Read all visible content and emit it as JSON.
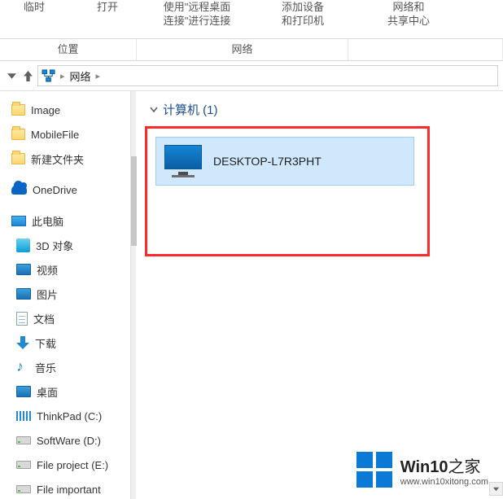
{
  "ribbon": {
    "items": [
      {
        "line1": "临时",
        "line2": ""
      },
      {
        "line1": "打开",
        "line2": ""
      },
      {
        "line1": "使用\"远程桌面",
        "line2": "连接\"进行连接"
      },
      {
        "line1": "添加设备",
        "line2": "和打印机"
      },
      {
        "line1": "网络和",
        "line2": "共享中心"
      }
    ],
    "sections": [
      "位置",
      "网络",
      ""
    ]
  },
  "address": {
    "crumb": "网络"
  },
  "sidebar": {
    "items": [
      {
        "label": "Image",
        "icon": "folder",
        "depth": 0
      },
      {
        "label": "MobileFile",
        "icon": "folder",
        "depth": 0
      },
      {
        "label": "新建文件夹",
        "icon": "folder",
        "depth": 0
      },
      {
        "label": "",
        "icon": "spacer",
        "depth": 0
      },
      {
        "label": "OneDrive",
        "icon": "onedrive",
        "depth": 0
      },
      {
        "label": "",
        "icon": "spacer",
        "depth": 0
      },
      {
        "label": "此电脑",
        "icon": "thispc",
        "depth": 0
      },
      {
        "label": "3D 对象",
        "icon": "obj3d",
        "depth": 1
      },
      {
        "label": "视频",
        "icon": "video",
        "depth": 1
      },
      {
        "label": "图片",
        "icon": "pic",
        "depth": 1
      },
      {
        "label": "文档",
        "icon": "doc",
        "depth": 1
      },
      {
        "label": "下载",
        "icon": "dl",
        "depth": 1
      },
      {
        "label": "音乐",
        "icon": "music",
        "depth": 1
      },
      {
        "label": "桌面",
        "icon": "desk",
        "depth": 1
      },
      {
        "label": "ThinkPad (C:)",
        "icon": "tp",
        "depth": 1
      },
      {
        "label": "SoftWare (D:)",
        "icon": "drive",
        "depth": 1
      },
      {
        "label": "File project (E:)",
        "icon": "drive",
        "depth": 1
      },
      {
        "label": "File important",
        "icon": "drive",
        "depth": 1
      }
    ]
  },
  "content": {
    "group_label": "计算机 (1)",
    "computer_name": "DESKTOP-L7R3PHT"
  },
  "watermark": {
    "brand": "Win10",
    "suffix": "之家",
    "url": "www.win10xitong.com"
  }
}
